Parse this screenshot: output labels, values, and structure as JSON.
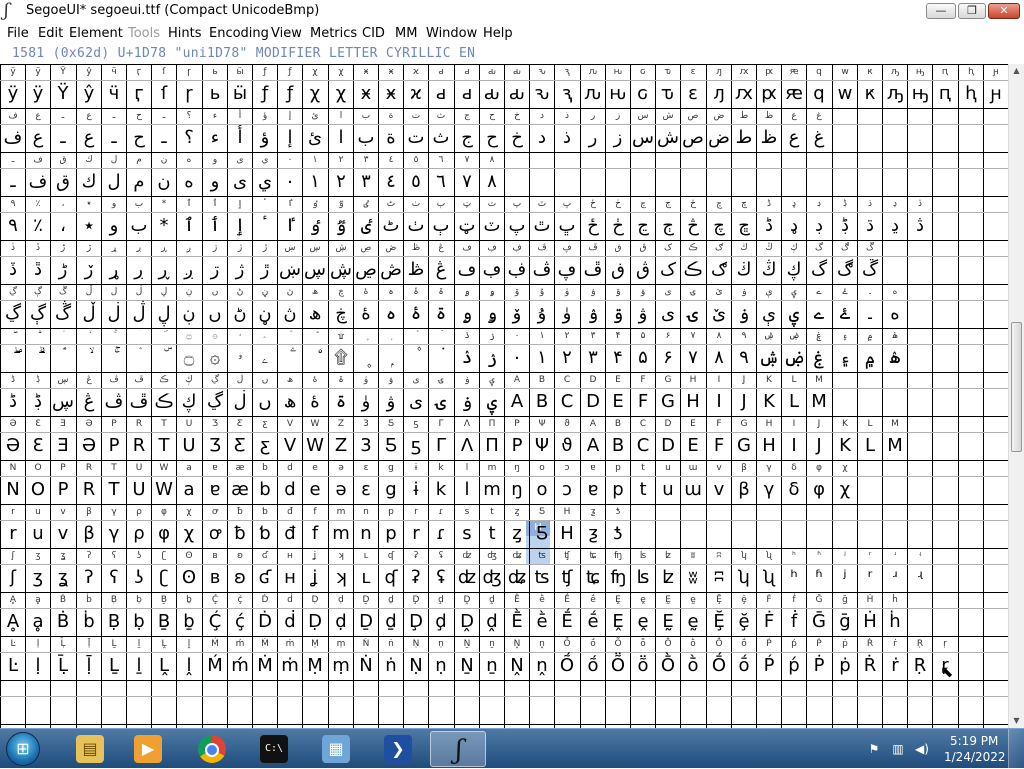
{
  "window": {
    "title": "SegoeUI* segoeui.ttf (Compact UnicodeBmp)",
    "app_icon": "fontforge-icon",
    "controls": {
      "minimize": "minimize-icon",
      "maximize": "maximize-icon",
      "close": "close-icon"
    }
  },
  "menu": [
    {
      "label": "File",
      "enabled": true
    },
    {
      "label": "Edit",
      "enabled": true
    },
    {
      "label": "Element",
      "enabled": true
    },
    {
      "label": "Tools",
      "enabled": false
    },
    {
      "label": "Hints",
      "enabled": true
    },
    {
      "label": "Encoding",
      "enabled": true
    },
    {
      "label": "View",
      "enabled": true
    },
    {
      "label": "Metrics",
      "enabled": true
    },
    {
      "label": "CID",
      "enabled": true
    },
    {
      "label": "MM",
      "enabled": true
    },
    {
      "label": "Window",
      "enabled": true
    },
    {
      "label": "Help",
      "enabled": true
    }
  ],
  "glyph_info": "1581 (0x62d) U+1D78 \"uni1D78\" MODIFIER LETTER CYRILLIC EN",
  "glyph_grid": {
    "selected_label": "H",
    "rows": [
      "ÿÿŸŷӵӷſɼьӹƒƒχχӿӿϰԁԁԃԃԅԇԉԋԍԏԑԓԕԗԙԛԝԟԡԣԥԧԩ",
      "فعـعـحـ؟ءأؤإئابةتثجحخدذرزسشصضطظعغ",
      "ـفقكلمنهوىي٠١٢٣٤٥٦٧٨",
      "٩٪،٭وب*ٱٲٳٴٵٶٷٸٹٺٻټٽپٿڀځڂڃڄڅچڇڈډڊڋڌڍڎ",
      "ڏڐڑڒړڔڕږڗژڙښڛڜڝڞڟڠڡڢڣڤڥڦڧڨکڪګڬڭڮگڰڱ",
      "ڲڳڴڵڶڷڸڹںڻڼڽھڿۀہۂۃۄۅۆۇۈۉۊۋیۍێۏېۑےۓ۔ە",
      "ۖۗۘۙۚۛۜ۝۞ۥۦۧۨ۩۪ۭ۫۬ۮۯ۰۱۲۳۴۵۶۷۸۹ۺۻۼ۽۾ۿ",
      "ڈڋڛڠڤڦڪڮڲڶںھۀۃۈۋیۍۏۑABCDEFGHIJKLM",
      "ƏƐƎƏPRTUƷƸƹVWZ3ƼƽΓΛΠΡΨϑABCDEFGHIJKLM",
      "NOPRTUWaɐæbdeəɛgɨklmŋoɔɐptuɯvβγδφχ",
      "ruvβγρφχꝍƀƅđfmnprɾstȥƼHƺƾ",
      "ʃʒʓʔʕʖʗʘʙʚʛʜʝʞʟʠʡʢʣʤʥʦʧʨʩʪʫʬʭʮʯʰʱʲʳʴʵ",
      "ḀḁḂḃḄḅḆḇḈḉḊḋḌḍḎḏḐḑḒḓḔḕḖḗḘḙḚḛḜḝḞḟḠḡḢḣ",
      "ĿḷḸḹḺḻḼḽḾḿṀṁṂṃṄṅṆṇṈṉṊṋṌṍṎṏṐṑṒṓṔṕṖṗṘṙṚṛ"
    ]
  },
  "scrollbar": {
    "up": "scroll-up-arrow-icon",
    "down": "scroll-down-arrow-icon"
  },
  "taskbar": {
    "start": "windows-start-orb-icon",
    "items": [
      {
        "name": "windows-explorer-icon",
        "active": false
      },
      {
        "name": "media-player-icon",
        "active": false
      },
      {
        "name": "chrome-icon",
        "active": false
      },
      {
        "name": "command-prompt-icon",
        "active": false
      },
      {
        "name": "remote-desktop-icon",
        "active": false
      },
      {
        "name": "powershell-icon",
        "active": false
      },
      {
        "name": "fontforge-taskbar-icon",
        "active": true
      }
    ],
    "tray": [
      "action-center-flag-icon",
      "network-icon",
      "volume-icon"
    ],
    "time": "5:19 PM",
    "date": "1/24/2022"
  }
}
